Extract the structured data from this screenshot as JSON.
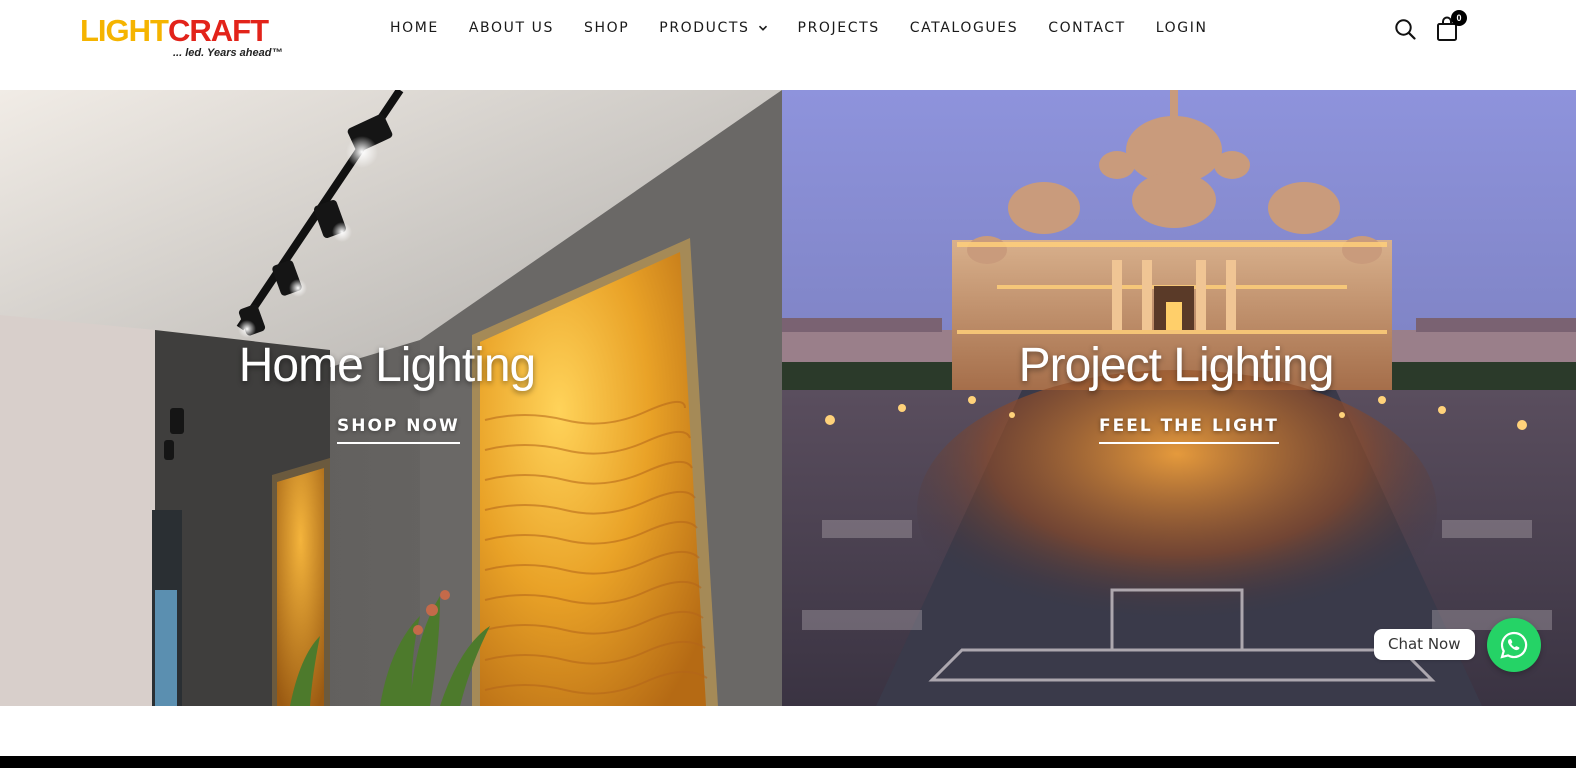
{
  "brand": {
    "logo_light": "LIGHT",
    "logo_craft": "CRAFT",
    "tagline": "... led. Years ahead™"
  },
  "nav": {
    "items": [
      {
        "label": "HOME"
      },
      {
        "label": "ABOUT US"
      },
      {
        "label": "SHOP"
      },
      {
        "label": "PRODUCTS"
      },
      {
        "label": "PROJECTS"
      },
      {
        "label": "CATALOGUES"
      },
      {
        "label": "CONTACT"
      },
      {
        "label": "LOGIN"
      }
    ]
  },
  "header_icons": {
    "search": "search-icon",
    "cart": "shopping-bag-icon",
    "cart_count": "0"
  },
  "hero": {
    "left": {
      "title": "Home Lighting",
      "cta": "SHOP NOW"
    },
    "right": {
      "title": "Project Lighting",
      "cta": "FEEL THE LIGHT"
    }
  },
  "chat": {
    "label": "Chat Now",
    "icon": "whatsapp-icon"
  },
  "colors": {
    "brand_yellow": "#f5b400",
    "brand_red": "#e2231a",
    "chat_green": "#25d366"
  }
}
